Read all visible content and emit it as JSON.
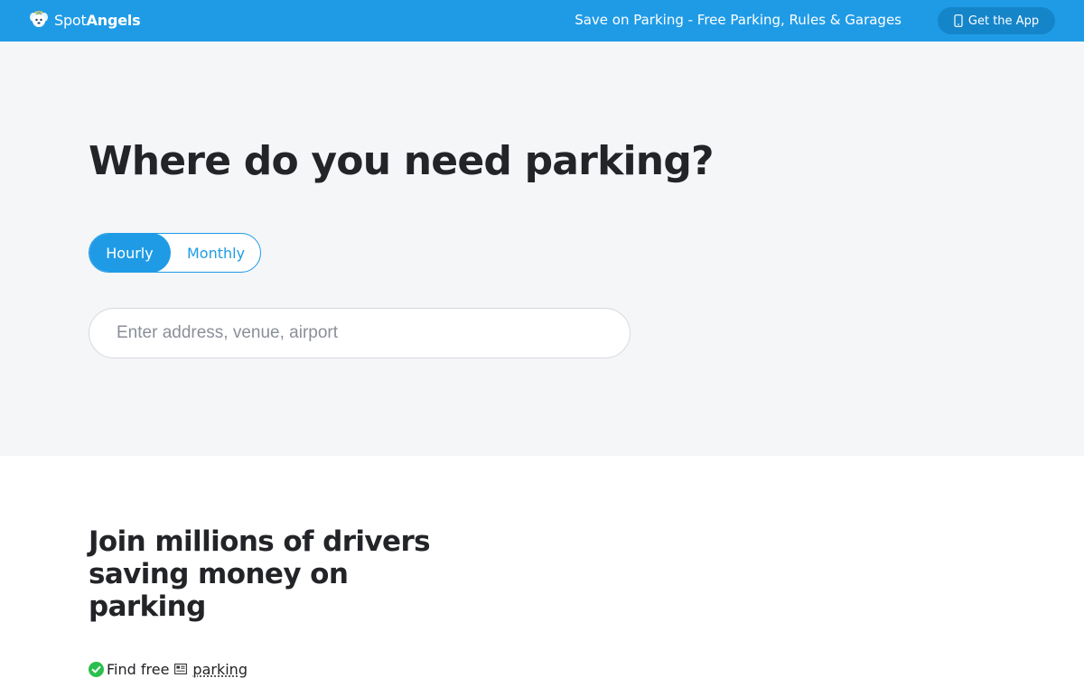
{
  "header": {
    "brand_bold_part": "Spot",
    "brand_second_part": "Angels",
    "tagline": "Save on Parking - Free Parking, Rules & Garages",
    "app_button_label": "Get the App",
    "bar_color": "#1f9be6",
    "app_button_color": "#1585ca",
    "icons": [
      "spotangels-logo-icon",
      "phone-icon"
    ]
  },
  "hero": {
    "title": "Where do you need parking?",
    "toggle": {
      "options": [
        {
          "label": "Hourly",
          "selected": true
        },
        {
          "label": "Monthly",
          "selected": false
        }
      ]
    },
    "search": {
      "value": "",
      "placeholder": "Enter address, venue, airport"
    },
    "background_color": "#f5f6f8"
  },
  "join": {
    "title": "Join millions of drivers saving money on parking",
    "features": [
      {
        "text": "Find free",
        "link_text": "parking",
        "icons": [
          "check-circle-icon",
          "card-icon"
        ]
      }
    ]
  },
  "colors": {
    "accent": "#1f9be6",
    "check_green": "#2bbf4e",
    "heading": "#232428"
  }
}
